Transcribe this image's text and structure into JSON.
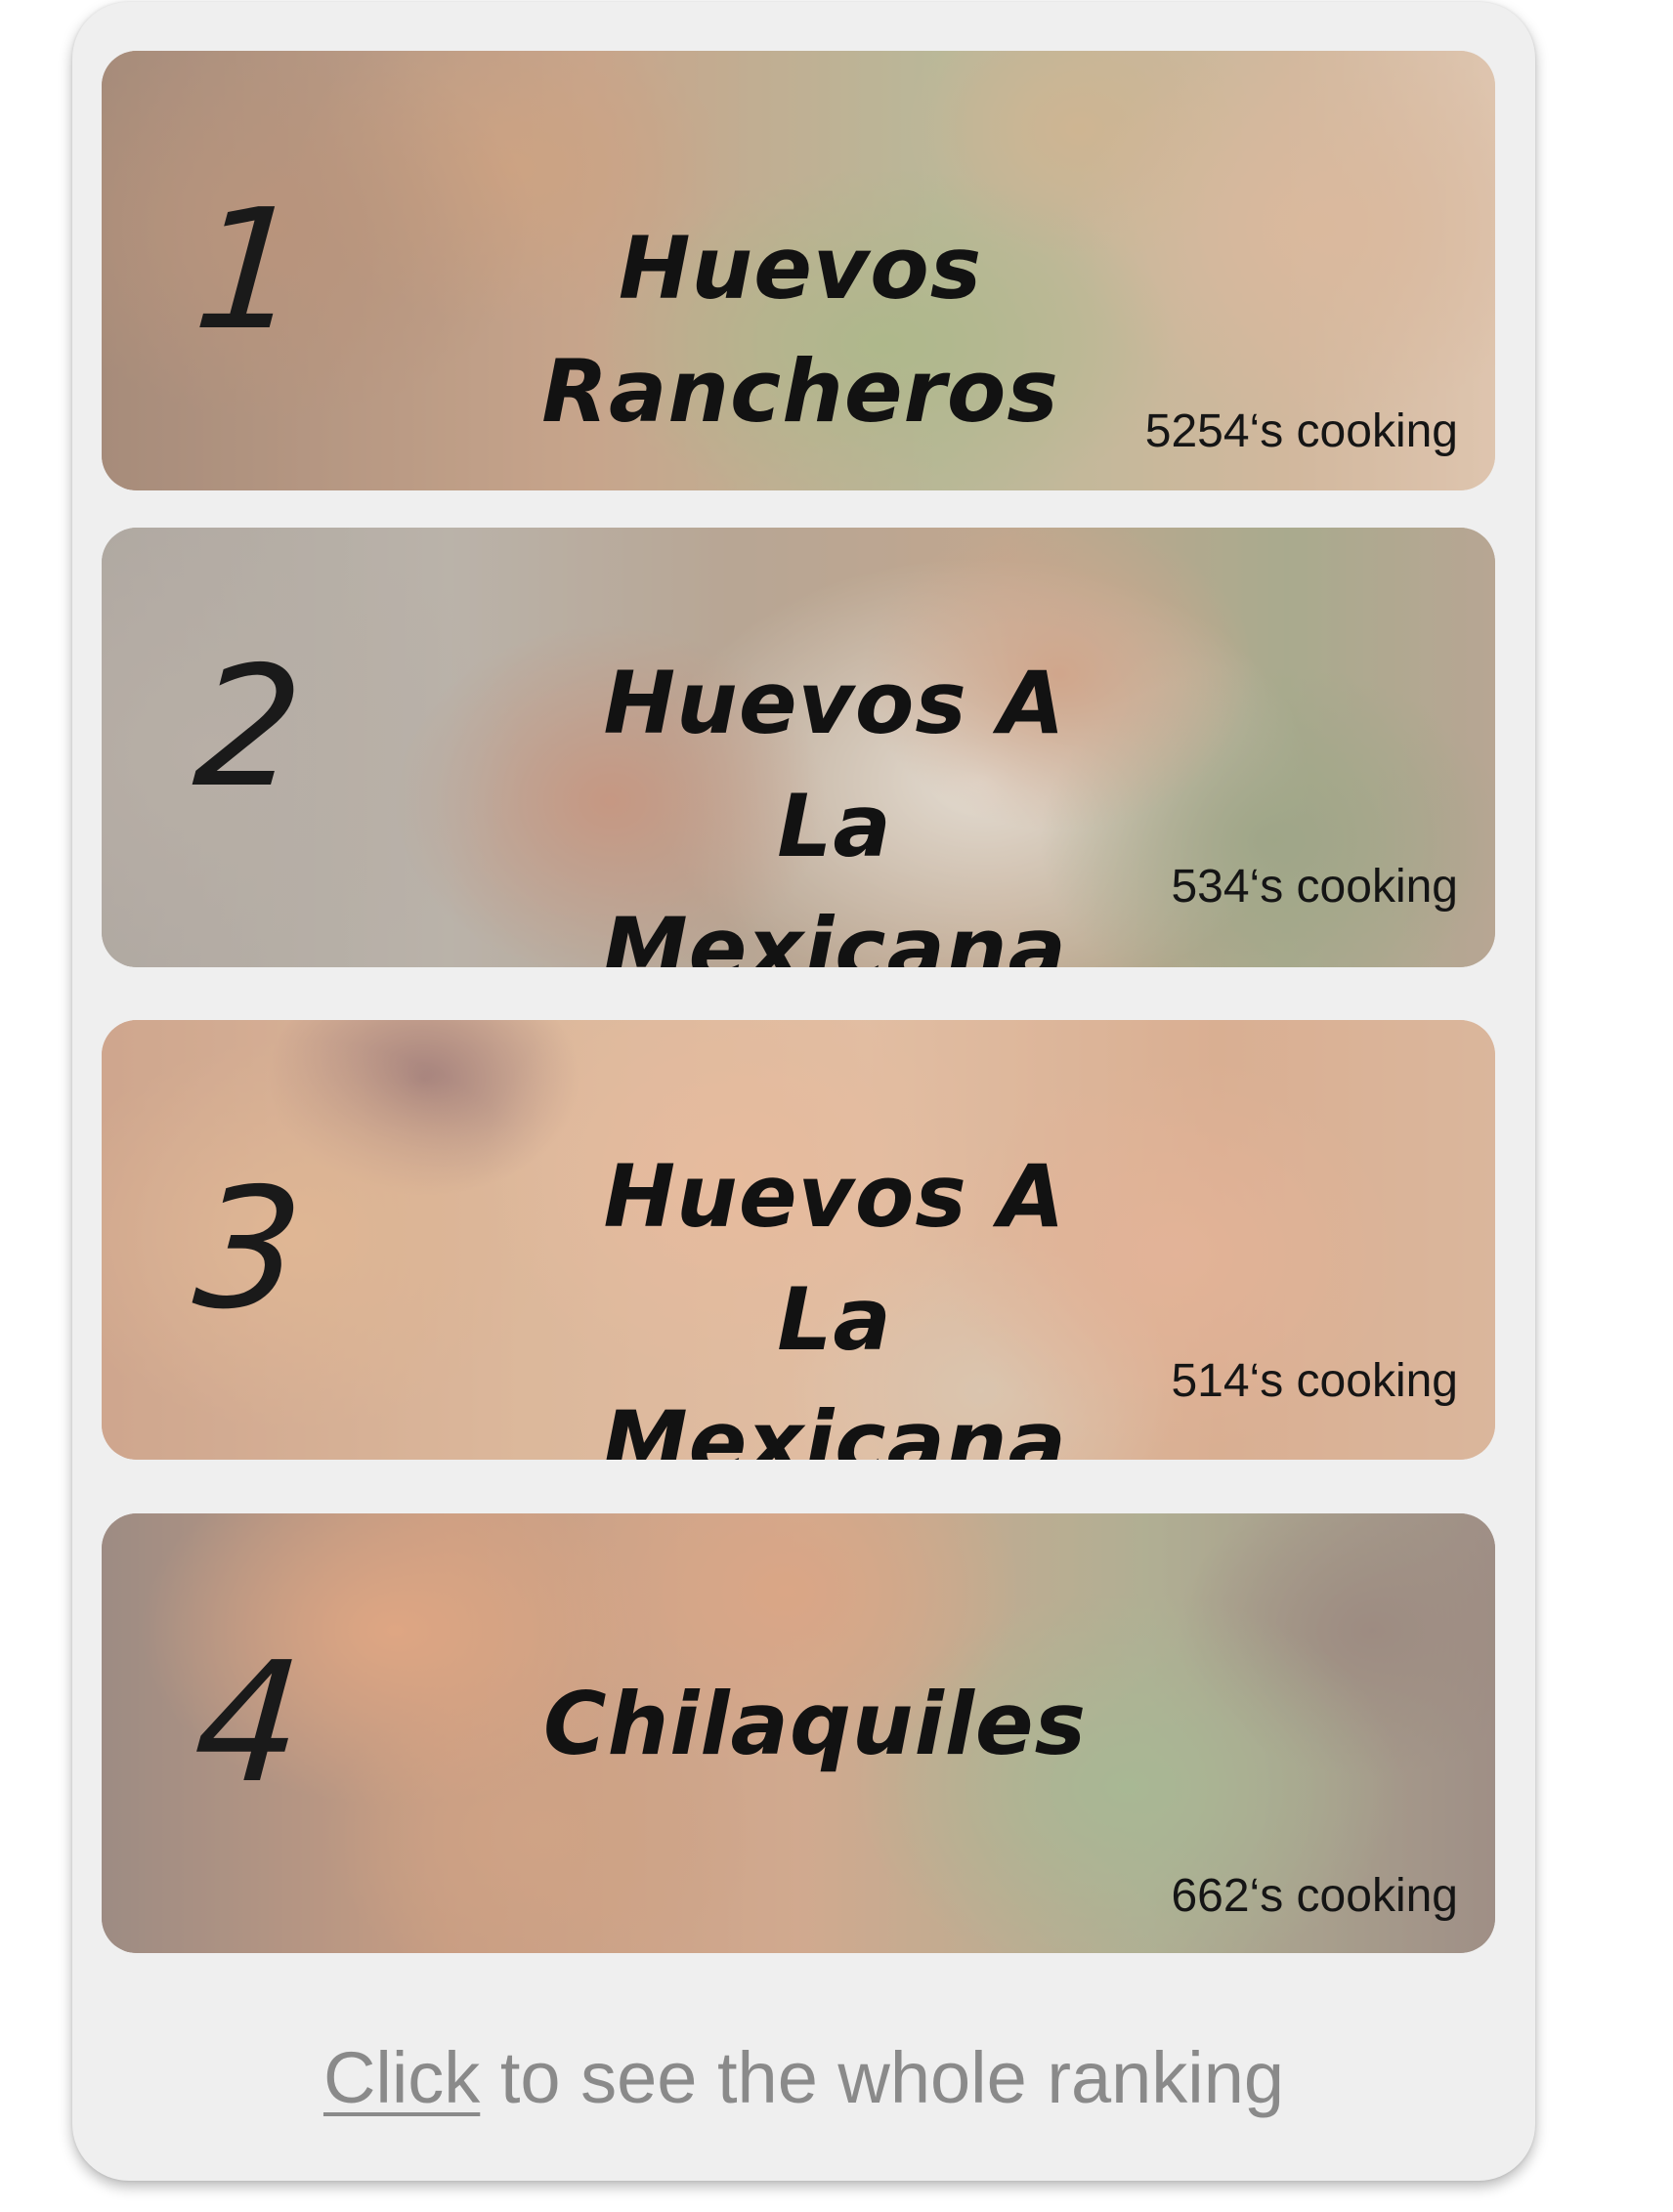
{
  "ranking": {
    "items": [
      {
        "rank": "1",
        "title": "Huevos Rancheros",
        "cooking": "5254‘s cooking"
      },
      {
        "rank": "2",
        "title": "Huevos A La Mexicana",
        "cooking": "534‘s cooking"
      },
      {
        "rank": "3",
        "title": "Huevos A La Mexicana",
        "cooking": "514‘s cooking"
      },
      {
        "rank": "4",
        "title": "Chilaquiles",
        "cooking": "662‘s cooking"
      }
    ]
  },
  "footer": {
    "link_label": "Click",
    "rest_label": " to see the whole ranking"
  },
  "colors": {
    "panel_background": "#efefef",
    "text_dark": "#121212",
    "footer_text": "#8a8a8a"
  }
}
